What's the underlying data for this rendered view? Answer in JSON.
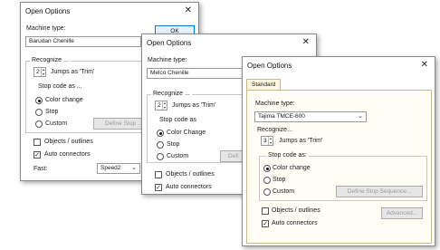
{
  "dialog1": {
    "title": "Open Options",
    "close_glyph": "✕",
    "machine_type_label": "Machine type:",
    "machine_type_value": "Barudan Chenille",
    "ok_label": "OK",
    "recognize_label": "Recognize ...",
    "jumps_value": "2",
    "jumps_label": "Jumps as 'Trim'",
    "stop_code_label": "Stop code as ...",
    "color_change_label": "Color change",
    "stop_label": "Stop",
    "custom_label": "Custom",
    "define_stop_label": "Define Stop ...",
    "objects_outlines_label": "Objects / outlines",
    "auto_connectors_label": "Auto connectors",
    "fast_label": "Fast:",
    "fast_value": "Speed2"
  },
  "dialog2": {
    "title": "Open Options",
    "close_glyph": "✕",
    "machine_type_label": "Machine type:",
    "machine_type_value": "Melco Chenille",
    "recognize_label": "Recognize ...",
    "jumps_value": "2",
    "jumps_label": "Jumps as 'Trim'",
    "stop_code_label": "Stop code as",
    "color_change_label": "Color Change",
    "stop_label": "Stop",
    "custom_label": "Custom",
    "define_label": "Defi",
    "objects_outlines_label": "Objects / outlines",
    "auto_connectors_label": "Auto connectors"
  },
  "dialog3": {
    "title": "Open Options",
    "close_glyph": "✕",
    "tab_label": "Standard",
    "machine_type_label": "Machine type:",
    "machine_type_value": "Tajima TMCE-600",
    "recognize_label": "Recognize...",
    "jumps_value": "3",
    "jumps_label": "Jumps as 'Trim'",
    "stop_code_label": "Stop code as:",
    "color_change_label": "Color change",
    "stop_label": "Stop",
    "custom_label": "Custom",
    "define_stop_label": "Define Stop Sequence...",
    "objects_outlines_label": "Objects / outlines",
    "advanced_label": "Advanced...",
    "auto_connectors_label": "Auto connectors"
  },
  "icons": {
    "check_glyph": "✓",
    "chevron_glyph": "⌄",
    "spin_up": "▲",
    "spin_down": "▼"
  }
}
